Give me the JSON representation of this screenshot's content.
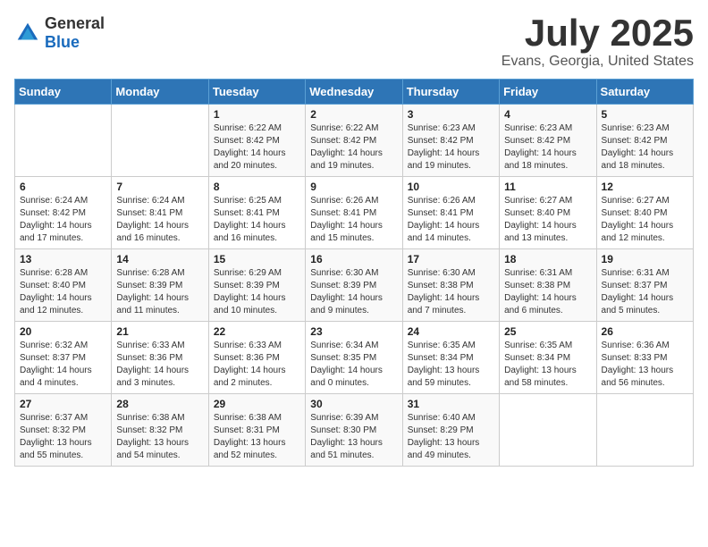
{
  "logo": {
    "text_general": "General",
    "text_blue": "Blue"
  },
  "header": {
    "month": "July 2025",
    "location": "Evans, Georgia, United States"
  },
  "weekdays": [
    "Sunday",
    "Monday",
    "Tuesday",
    "Wednesday",
    "Thursday",
    "Friday",
    "Saturday"
  ],
  "weeks": [
    [
      {
        "day": "",
        "sunrise": "",
        "sunset": "",
        "daylight": ""
      },
      {
        "day": "",
        "sunrise": "",
        "sunset": "",
        "daylight": ""
      },
      {
        "day": "1",
        "sunrise": "Sunrise: 6:22 AM",
        "sunset": "Sunset: 8:42 PM",
        "daylight": "Daylight: 14 hours and 20 minutes."
      },
      {
        "day": "2",
        "sunrise": "Sunrise: 6:22 AM",
        "sunset": "Sunset: 8:42 PM",
        "daylight": "Daylight: 14 hours and 19 minutes."
      },
      {
        "day": "3",
        "sunrise": "Sunrise: 6:23 AM",
        "sunset": "Sunset: 8:42 PM",
        "daylight": "Daylight: 14 hours and 19 minutes."
      },
      {
        "day": "4",
        "sunrise": "Sunrise: 6:23 AM",
        "sunset": "Sunset: 8:42 PM",
        "daylight": "Daylight: 14 hours and 18 minutes."
      },
      {
        "day": "5",
        "sunrise": "Sunrise: 6:23 AM",
        "sunset": "Sunset: 8:42 PM",
        "daylight": "Daylight: 14 hours and 18 minutes."
      }
    ],
    [
      {
        "day": "6",
        "sunrise": "Sunrise: 6:24 AM",
        "sunset": "Sunset: 8:42 PM",
        "daylight": "Daylight: 14 hours and 17 minutes."
      },
      {
        "day": "7",
        "sunrise": "Sunrise: 6:24 AM",
        "sunset": "Sunset: 8:41 PM",
        "daylight": "Daylight: 14 hours and 16 minutes."
      },
      {
        "day": "8",
        "sunrise": "Sunrise: 6:25 AM",
        "sunset": "Sunset: 8:41 PM",
        "daylight": "Daylight: 14 hours and 16 minutes."
      },
      {
        "day": "9",
        "sunrise": "Sunrise: 6:26 AM",
        "sunset": "Sunset: 8:41 PM",
        "daylight": "Daylight: 14 hours and 15 minutes."
      },
      {
        "day": "10",
        "sunrise": "Sunrise: 6:26 AM",
        "sunset": "Sunset: 8:41 PM",
        "daylight": "Daylight: 14 hours and 14 minutes."
      },
      {
        "day": "11",
        "sunrise": "Sunrise: 6:27 AM",
        "sunset": "Sunset: 8:40 PM",
        "daylight": "Daylight: 14 hours and 13 minutes."
      },
      {
        "day": "12",
        "sunrise": "Sunrise: 6:27 AM",
        "sunset": "Sunset: 8:40 PM",
        "daylight": "Daylight: 14 hours and 12 minutes."
      }
    ],
    [
      {
        "day": "13",
        "sunrise": "Sunrise: 6:28 AM",
        "sunset": "Sunset: 8:40 PM",
        "daylight": "Daylight: 14 hours and 12 minutes."
      },
      {
        "day": "14",
        "sunrise": "Sunrise: 6:28 AM",
        "sunset": "Sunset: 8:39 PM",
        "daylight": "Daylight: 14 hours and 11 minutes."
      },
      {
        "day": "15",
        "sunrise": "Sunrise: 6:29 AM",
        "sunset": "Sunset: 8:39 PM",
        "daylight": "Daylight: 14 hours and 10 minutes."
      },
      {
        "day": "16",
        "sunrise": "Sunrise: 6:30 AM",
        "sunset": "Sunset: 8:39 PM",
        "daylight": "Daylight: 14 hours and 9 minutes."
      },
      {
        "day": "17",
        "sunrise": "Sunrise: 6:30 AM",
        "sunset": "Sunset: 8:38 PM",
        "daylight": "Daylight: 14 hours and 7 minutes."
      },
      {
        "day": "18",
        "sunrise": "Sunrise: 6:31 AM",
        "sunset": "Sunset: 8:38 PM",
        "daylight": "Daylight: 14 hours and 6 minutes."
      },
      {
        "day": "19",
        "sunrise": "Sunrise: 6:31 AM",
        "sunset": "Sunset: 8:37 PM",
        "daylight": "Daylight: 14 hours and 5 minutes."
      }
    ],
    [
      {
        "day": "20",
        "sunrise": "Sunrise: 6:32 AM",
        "sunset": "Sunset: 8:37 PM",
        "daylight": "Daylight: 14 hours and 4 minutes."
      },
      {
        "day": "21",
        "sunrise": "Sunrise: 6:33 AM",
        "sunset": "Sunset: 8:36 PM",
        "daylight": "Daylight: 14 hours and 3 minutes."
      },
      {
        "day": "22",
        "sunrise": "Sunrise: 6:33 AM",
        "sunset": "Sunset: 8:36 PM",
        "daylight": "Daylight: 14 hours and 2 minutes."
      },
      {
        "day": "23",
        "sunrise": "Sunrise: 6:34 AM",
        "sunset": "Sunset: 8:35 PM",
        "daylight": "Daylight: 14 hours and 0 minutes."
      },
      {
        "day": "24",
        "sunrise": "Sunrise: 6:35 AM",
        "sunset": "Sunset: 8:34 PM",
        "daylight": "Daylight: 13 hours and 59 minutes."
      },
      {
        "day": "25",
        "sunrise": "Sunrise: 6:35 AM",
        "sunset": "Sunset: 8:34 PM",
        "daylight": "Daylight: 13 hours and 58 minutes."
      },
      {
        "day": "26",
        "sunrise": "Sunrise: 6:36 AM",
        "sunset": "Sunset: 8:33 PM",
        "daylight": "Daylight: 13 hours and 56 minutes."
      }
    ],
    [
      {
        "day": "27",
        "sunrise": "Sunrise: 6:37 AM",
        "sunset": "Sunset: 8:32 PM",
        "daylight": "Daylight: 13 hours and 55 minutes."
      },
      {
        "day": "28",
        "sunrise": "Sunrise: 6:38 AM",
        "sunset": "Sunset: 8:32 PM",
        "daylight": "Daylight: 13 hours and 54 minutes."
      },
      {
        "day": "29",
        "sunrise": "Sunrise: 6:38 AM",
        "sunset": "Sunset: 8:31 PM",
        "daylight": "Daylight: 13 hours and 52 minutes."
      },
      {
        "day": "30",
        "sunrise": "Sunrise: 6:39 AM",
        "sunset": "Sunset: 8:30 PM",
        "daylight": "Daylight: 13 hours and 51 minutes."
      },
      {
        "day": "31",
        "sunrise": "Sunrise: 6:40 AM",
        "sunset": "Sunset: 8:29 PM",
        "daylight": "Daylight: 13 hours and 49 minutes."
      },
      {
        "day": "",
        "sunrise": "",
        "sunset": "",
        "daylight": ""
      },
      {
        "day": "",
        "sunrise": "",
        "sunset": "",
        "daylight": ""
      }
    ]
  ]
}
